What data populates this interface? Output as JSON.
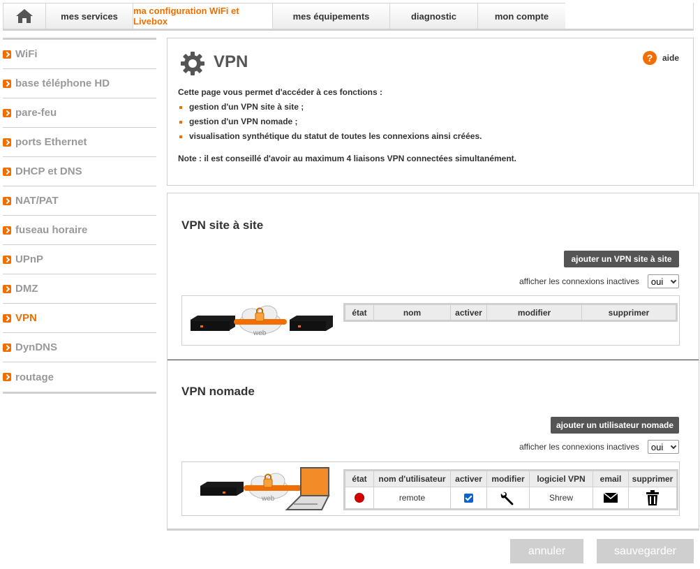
{
  "topnav": {
    "tabs": [
      {
        "label": "mes services"
      },
      {
        "label": "ma configuration WiFi et Livebox"
      },
      {
        "label": "mes équipements"
      },
      {
        "label": "diagnostic"
      },
      {
        "label": "mon compte"
      }
    ],
    "active_color": "#f16e00"
  },
  "sidebar": {
    "items": [
      {
        "label": "WiFi"
      },
      {
        "label": "base téléphone HD"
      },
      {
        "label": "pare-feu"
      },
      {
        "label": "ports Ethernet"
      },
      {
        "label": "DHCP et DNS"
      },
      {
        "label": "NAT/PAT"
      },
      {
        "label": "fuseau horaire"
      },
      {
        "label": "UPnP"
      },
      {
        "label": "DMZ"
      },
      {
        "label": "VPN"
      },
      {
        "label": "DynDNS"
      },
      {
        "label": "routage"
      }
    ],
    "active": "VPN"
  },
  "intro": {
    "title": "VPN",
    "help_label": "aide",
    "help_glyph": "?",
    "lead": "Cette page vous permet d'accéder à ces fonctions :",
    "bullets": [
      "gestion d'un VPN site à site ;",
      "gestion d'un VPN nomade ;",
      "visualisation synthétique du statut de toutes les connexions ainsi créées."
    ],
    "note": "Note : il est conseillé d'avoir au maximum 4 liaisons VPN connectées simultanément."
  },
  "site": {
    "title": "VPN site à site",
    "add_button": "ajouter un VPN site à site",
    "filter_label": "afficher les connexions inactives",
    "filter_value": "oui",
    "illus_word": "web",
    "columns": [
      "état",
      "nom",
      "activer",
      "modifier",
      "supprimer"
    ]
  },
  "nomad": {
    "title": "VPN nomade",
    "add_button": "ajouter un utilisateur nomade",
    "filter_label": "afficher les connexions inactives",
    "filter_value": "oui",
    "illus_word": "web",
    "columns": [
      "état",
      "nom d'utilisateur",
      "activer",
      "modifier",
      "logiciel VPN",
      "email",
      "supprimer"
    ],
    "rows": [
      {
        "user": "remote",
        "software": "Shrew",
        "status_color": "#d40000",
        "enabled": true
      }
    ]
  },
  "footer": {
    "cancel": "annuler",
    "save": "sauvegarder"
  }
}
